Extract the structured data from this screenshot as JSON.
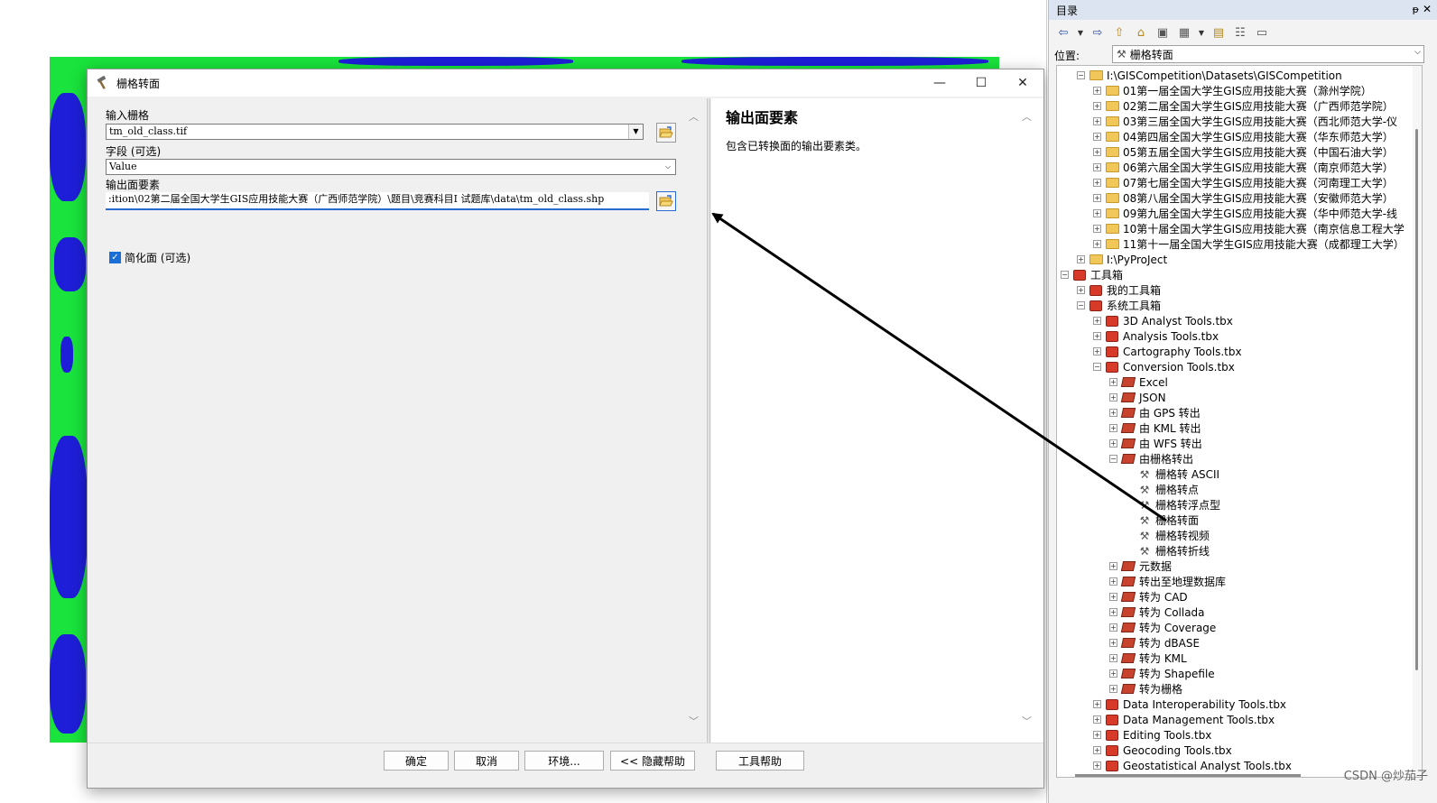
{
  "dialog": {
    "title": "栅格转面",
    "window_controls": {
      "minimize": "—",
      "maximize": "☐",
      "close": "✕"
    },
    "fields": {
      "input_raster_label": "输入栅格",
      "input_raster_value": "tm_old_class.tif",
      "field_label": "字段 (可选)",
      "field_value": "Value",
      "output_label": "输出面要素",
      "output_value": ":ition\\02第二届全国大学生GIS应用技能大赛（广西师范学院）\\题目\\竞赛科目I  试题库\\data\\tm_old_class.shp",
      "simplify_label": "简化面 (可选)",
      "simplify_checked": true
    },
    "help": {
      "title": "输出面要素",
      "text": "包含已转换面的输出要素类。"
    },
    "buttons": {
      "ok": "确定",
      "cancel": "取消",
      "env": "环境...",
      "hide_help": "<< 隐藏帮助",
      "tool_help": "工具帮助"
    }
  },
  "catalog": {
    "title": "目录",
    "pin": "ᵽ",
    "close": "✕",
    "location_label": "位置:",
    "location_value": "栅格转面",
    "tree": [
      {
        "depth": 1,
        "exp": "−",
        "icon": "folder",
        "label": "I:\\GISCompetition\\Datasets\\GISCompetition"
      },
      {
        "depth": 2,
        "exp": "+",
        "icon": "folder",
        "label": "01第一届全国大学生GIS应用技能大赛（滁州学院）"
      },
      {
        "depth": 2,
        "exp": "+",
        "icon": "folder",
        "label": "02第二届全国大学生GIS应用技能大赛（广西师范学院）"
      },
      {
        "depth": 2,
        "exp": "+",
        "icon": "folder",
        "label": "03第三届全国大学生GIS应用技能大赛（西北师范大学-仪"
      },
      {
        "depth": 2,
        "exp": "+",
        "icon": "folder",
        "label": "04第四届全国大学生GIS应用技能大赛（华东师范大学）"
      },
      {
        "depth": 2,
        "exp": "+",
        "icon": "folder",
        "label": "05第五届全国大学生GIS应用技能大赛（中国石油大学）"
      },
      {
        "depth": 2,
        "exp": "+",
        "icon": "folder",
        "label": "06第六届全国大学生GIS应用技能大赛（南京师范大学）"
      },
      {
        "depth": 2,
        "exp": "+",
        "icon": "folder",
        "label": "07第七届全国大学生GIS应用技能大赛（河南理工大学）"
      },
      {
        "depth": 2,
        "exp": "+",
        "icon": "folder",
        "label": "08第八届全国大学生GIS应用技能大赛（安徽师范大学）"
      },
      {
        "depth": 2,
        "exp": "+",
        "icon": "folder",
        "label": "09第九届全国大学生GIS应用技能大赛（华中师范大学-线"
      },
      {
        "depth": 2,
        "exp": "+",
        "icon": "folder",
        "label": "10第十届全国大学生GIS应用技能大赛（南京信息工程大学"
      },
      {
        "depth": 2,
        "exp": "+",
        "icon": "folder",
        "label": "11第十一届全国大学生GIS应用技能大赛（成都理工大学）"
      },
      {
        "depth": 1,
        "exp": "+",
        "icon": "folder",
        "label": "I:\\PyProJect"
      },
      {
        "depth": 0,
        "exp": "−",
        "icon": "toolbox",
        "label": "工具箱"
      },
      {
        "depth": 1,
        "exp": "+",
        "icon": "toolbox",
        "label": "我的工具箱"
      },
      {
        "depth": 1,
        "exp": "−",
        "icon": "toolbox",
        "label": "系统工具箱"
      },
      {
        "depth": 2,
        "exp": "+",
        "icon": "toolbox",
        "label": "3D Analyst Tools.tbx"
      },
      {
        "depth": 2,
        "exp": "+",
        "icon": "toolbox",
        "label": "Analysis Tools.tbx"
      },
      {
        "depth": 2,
        "exp": "+",
        "icon": "toolbox",
        "label": "Cartography Tools.tbx"
      },
      {
        "depth": 2,
        "exp": "−",
        "icon": "toolbox",
        "label": "Conversion Tools.tbx"
      },
      {
        "depth": 3,
        "exp": "+",
        "icon": "toolset",
        "label": "Excel"
      },
      {
        "depth": 3,
        "exp": "+",
        "icon": "toolset",
        "label": "JSON"
      },
      {
        "depth": 3,
        "exp": "+",
        "icon": "toolset",
        "label": "由 GPS 转出"
      },
      {
        "depth": 3,
        "exp": "+",
        "icon": "toolset",
        "label": "由 KML 转出"
      },
      {
        "depth": 3,
        "exp": "+",
        "icon": "toolset",
        "label": "由 WFS 转出"
      },
      {
        "depth": 3,
        "exp": "−",
        "icon": "toolset",
        "label": "由栅格转出"
      },
      {
        "depth": 4,
        "exp": "",
        "icon": "hammer",
        "label": "栅格转 ASCII"
      },
      {
        "depth": 4,
        "exp": "",
        "icon": "hammer",
        "label": "栅格转点"
      },
      {
        "depth": 4,
        "exp": "",
        "icon": "hammer",
        "label": "栅格转浮点型"
      },
      {
        "depth": 4,
        "exp": "",
        "icon": "hammer",
        "label": "栅格转面"
      },
      {
        "depth": 4,
        "exp": "",
        "icon": "hammer",
        "label": "栅格转视频"
      },
      {
        "depth": 4,
        "exp": "",
        "icon": "hammer",
        "label": "栅格转折线"
      },
      {
        "depth": 3,
        "exp": "+",
        "icon": "toolset",
        "label": "元数据"
      },
      {
        "depth": 3,
        "exp": "+",
        "icon": "toolset",
        "label": "转出至地理数据库"
      },
      {
        "depth": 3,
        "exp": "+",
        "icon": "toolset",
        "label": "转为 CAD"
      },
      {
        "depth": 3,
        "exp": "+",
        "icon": "toolset",
        "label": "转为 Collada"
      },
      {
        "depth": 3,
        "exp": "+",
        "icon": "toolset",
        "label": "转为 Coverage"
      },
      {
        "depth": 3,
        "exp": "+",
        "icon": "toolset",
        "label": "转为 dBASE"
      },
      {
        "depth": 3,
        "exp": "+",
        "icon": "toolset",
        "label": "转为 KML"
      },
      {
        "depth": 3,
        "exp": "+",
        "icon": "toolset",
        "label": "转为 Shapefile"
      },
      {
        "depth": 3,
        "exp": "+",
        "icon": "toolset",
        "label": "转为栅格"
      },
      {
        "depth": 2,
        "exp": "+",
        "icon": "toolbox",
        "label": "Data Interoperability Tools.tbx"
      },
      {
        "depth": 2,
        "exp": "+",
        "icon": "toolbox",
        "label": "Data Management Tools.tbx"
      },
      {
        "depth": 2,
        "exp": "+",
        "icon": "toolbox",
        "label": "Editing Tools.tbx"
      },
      {
        "depth": 2,
        "exp": "+",
        "icon": "toolbox",
        "label": "Geocoding Tools.tbx"
      },
      {
        "depth": 2,
        "exp": "+",
        "icon": "toolbox",
        "label": "Geostatistical Analyst Tools.tbx"
      }
    ]
  },
  "watermark": "CSDN @炒茄子",
  "colors": {
    "raster_green": "#19e33c",
    "raster_blue": "#1e1ed8",
    "accent": "#2a6bd3"
  }
}
